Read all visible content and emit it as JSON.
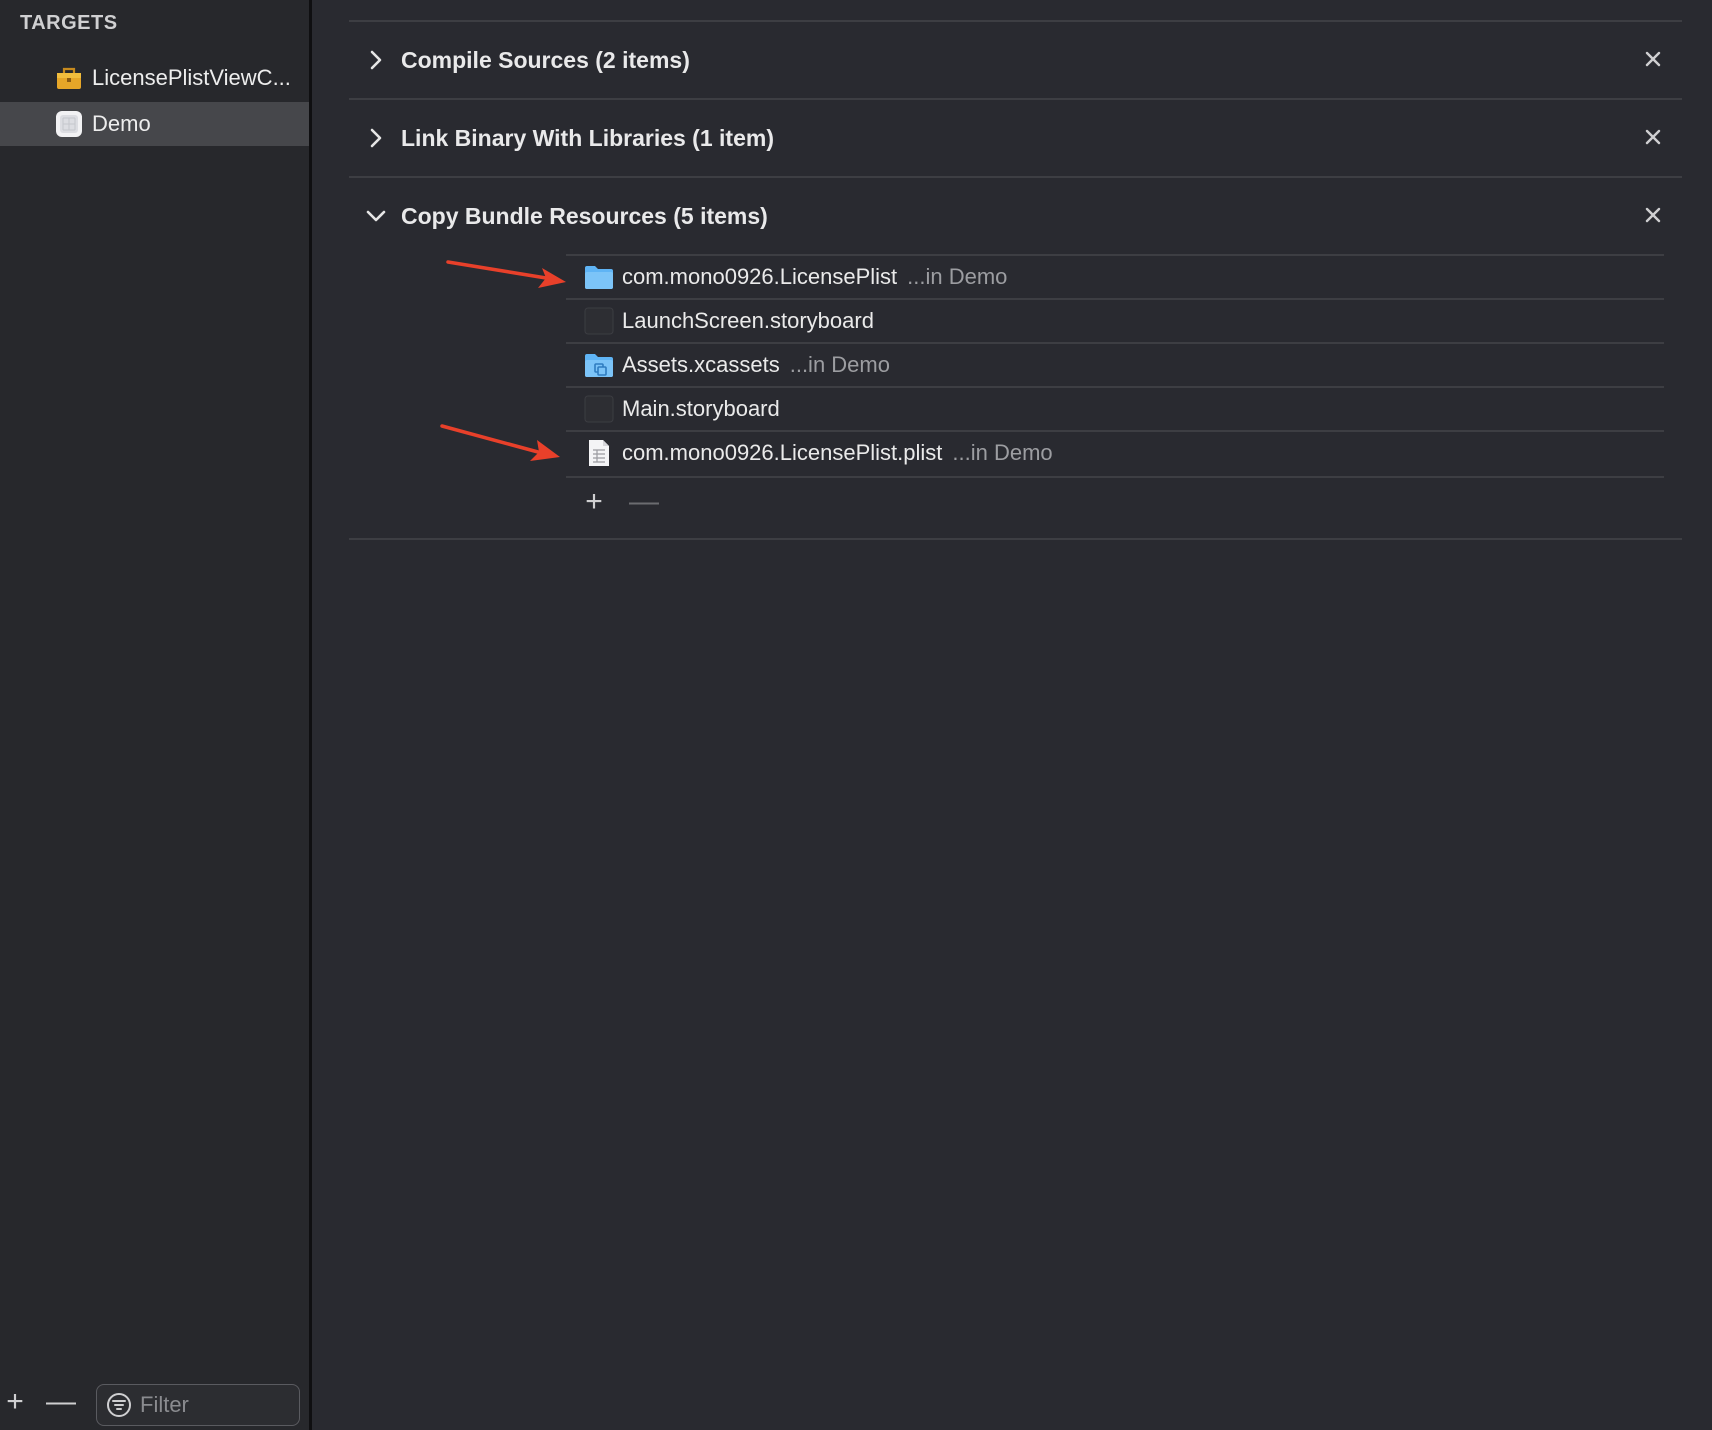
{
  "sidebar": {
    "header": "TARGETS",
    "targets": [
      {
        "label": "LicensePlistViewC...",
        "icon": "toolbox-icon",
        "selected": false
      },
      {
        "label": "Demo",
        "icon": "app-target-icon",
        "selected": true
      }
    ],
    "footer": {
      "add_label": "+",
      "remove_label": "—",
      "filter_placeholder": "Filter"
    }
  },
  "build_phases": [
    {
      "title": "Compile Sources (2 items)",
      "expanded": false
    },
    {
      "title": "Link Binary With Libraries (1 item)",
      "expanded": false
    },
    {
      "title": "Copy Bundle Resources (5 items)",
      "expanded": true
    }
  ],
  "resources": [
    {
      "name": "com.mono0926.LicensePlist",
      "location": "...in Demo",
      "icon": "folder-icon"
    },
    {
      "name": "LaunchScreen.storyboard",
      "location": "",
      "icon": "storyboard-icon"
    },
    {
      "name": "Assets.xcassets",
      "location": "...in Demo",
      "icon": "asset-catalog-icon"
    },
    {
      "name": "Main.storyboard",
      "location": "",
      "icon": "storyboard-icon"
    },
    {
      "name": "com.mono0926.LicensePlist.plist",
      "location": "...in Demo",
      "icon": "plist-file-icon"
    }
  ],
  "resource_buttons": {
    "add_label": "+",
    "remove_label": "—"
  },
  "colors": {
    "background": "#292a30",
    "sidebar": "#27282c",
    "selection": "#46474b",
    "annotation_arrow": "#e8402a",
    "folder_blue": "#5fb4f5"
  }
}
